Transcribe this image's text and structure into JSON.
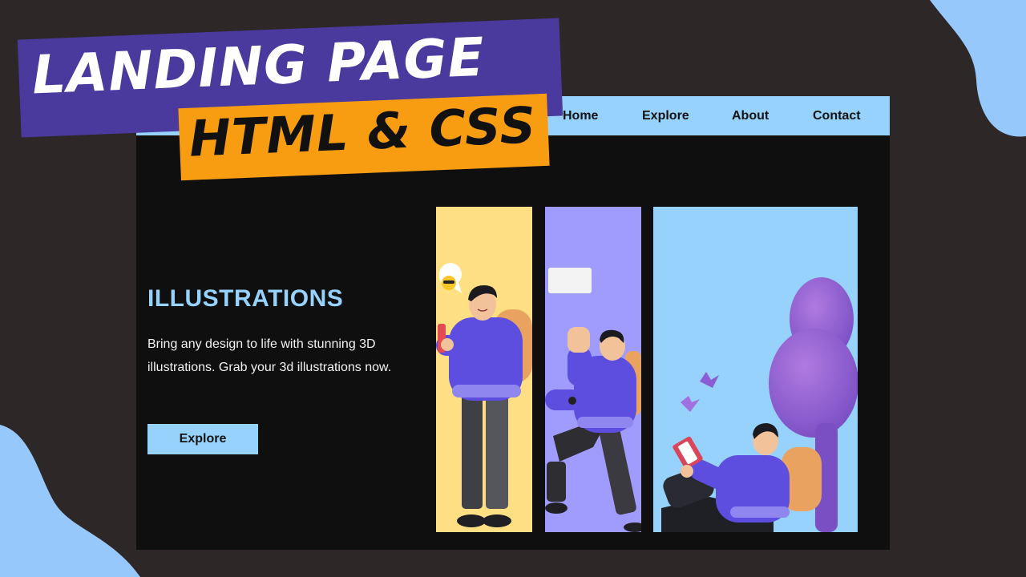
{
  "thumbnail": {
    "title_line1": "LANDING PAGE",
    "title_line2": "HTML & CSS"
  },
  "navbar": {
    "links": [
      {
        "label": "Home"
      },
      {
        "label": "Explore"
      },
      {
        "label": "About"
      },
      {
        "label": "Contact"
      }
    ]
  },
  "hero": {
    "title": "ILLUSTRATIONS",
    "description": "Bring any design to life with stunning 3D illustrations. Grab your 3d illustrations now.",
    "button_label": "Explore"
  },
  "illustrations": [
    {
      "icon": "character-with-phone-illustration",
      "background": "#fedf83"
    },
    {
      "icon": "character-running-with-flag-illustration",
      "background": "#a09cfd"
    },
    {
      "icon": "character-reading-under-tree-illustration",
      "background": "#96d2fb"
    }
  ],
  "colors": {
    "page_background": "#2d2728",
    "frame_background": "#0f0f0f",
    "accent_blue": "#96d2fb",
    "banner_purple": "#4a3a9e",
    "banner_orange": "#f89d12",
    "character_purple": "#5d4ee0"
  }
}
